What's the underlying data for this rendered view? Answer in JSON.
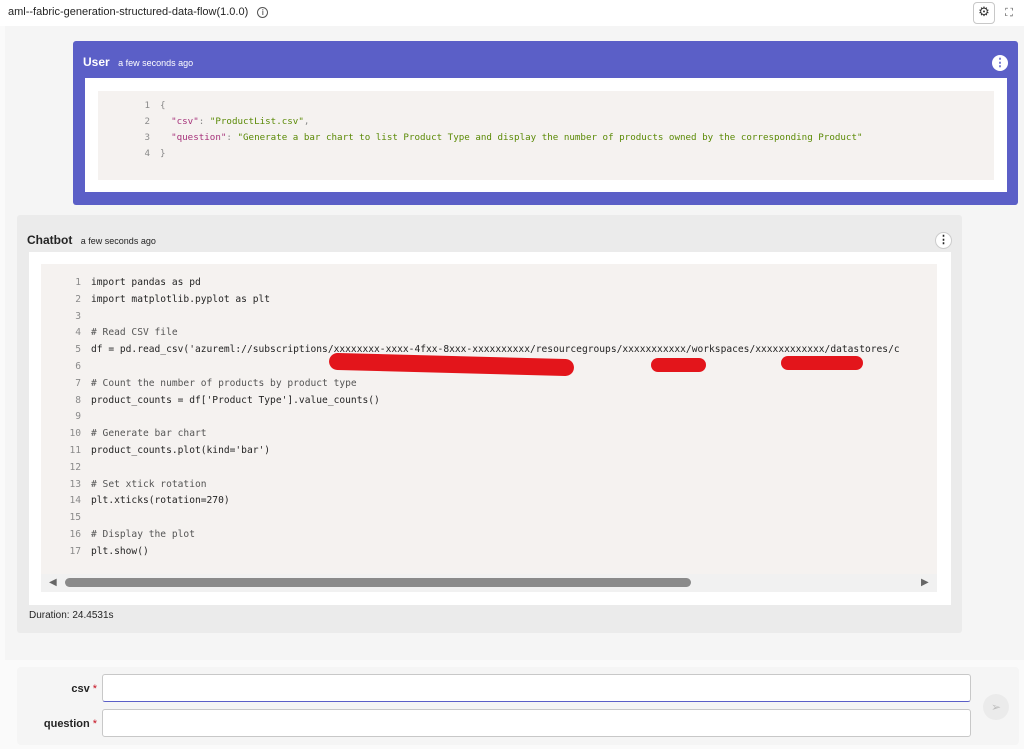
{
  "header": {
    "title": "aml--fabric-generation-structured-data-flow(1.0.0)",
    "info_icon": "info-icon",
    "settings_icon": "gear-icon",
    "expand_icon": "fullscreen-icon"
  },
  "user_message": {
    "author": "User",
    "time": "a few seconds ago",
    "menu_icon": "more-vertical-icon",
    "code_lines": [
      {
        "n": "1",
        "text": "{"
      },
      {
        "n": "2",
        "key": "\"csv\"",
        "value": "\"ProductList.csv\"",
        "tail": ","
      },
      {
        "n": "3",
        "key": "\"question\"",
        "value": "\"Generate a bar chart to list Product Type and display the number of products owned by the corresponding Product\"",
        "tail": ""
      },
      {
        "n": "4",
        "text": "}"
      }
    ]
  },
  "bot_message": {
    "author": "Chatbot",
    "time": "a few seconds ago",
    "menu_icon": "more-vertical-icon",
    "code_lines": [
      {
        "n": "1",
        "text": "import pandas as pd"
      },
      {
        "n": "2",
        "text": "import matplotlib.pyplot as plt"
      },
      {
        "n": "3",
        "text": ""
      },
      {
        "n": "4",
        "text": "# Read CSV file"
      },
      {
        "n": "5",
        "text": "df = pd.read_csv('azureml://subscriptions/xxxxxxxx-xxxx-4fxx-8xxx-xxxxxxxxxx/resourcegroups/xxxxxxxxxxx/workspaces/xxxxxxxxxxxx/datastores/c"
      },
      {
        "n": "6",
        "text": ""
      },
      {
        "n": "7",
        "text": "# Count the number of products by product type"
      },
      {
        "n": "8",
        "text": "product_counts = df['Product Type'].value_counts()"
      },
      {
        "n": "9",
        "text": ""
      },
      {
        "n": "10",
        "text": "# Generate bar chart"
      },
      {
        "n": "11",
        "text": "product_counts.plot(kind='bar')"
      },
      {
        "n": "12",
        "text": ""
      },
      {
        "n": "13",
        "text": "# Set xtick rotation"
      },
      {
        "n": "14",
        "text": "plt.xticks(rotation=270)"
      },
      {
        "n": "15",
        "text": ""
      },
      {
        "n": "16",
        "text": "# Display the plot"
      },
      {
        "n": "17",
        "text": "plt.show()"
      }
    ],
    "duration": "Duration: 24.4531s"
  },
  "inputs": {
    "csv_label": "csv",
    "question_label": "question",
    "required_mark": "*",
    "csv_value": "",
    "question_value": "",
    "send_icon": "send-icon"
  },
  "colors": {
    "accent": "#5b5fc7",
    "redaction": "#e3151b",
    "code_bg": "#f5f2f0",
    "json_key": "#a6327a",
    "json_string": "#5b8a06"
  }
}
